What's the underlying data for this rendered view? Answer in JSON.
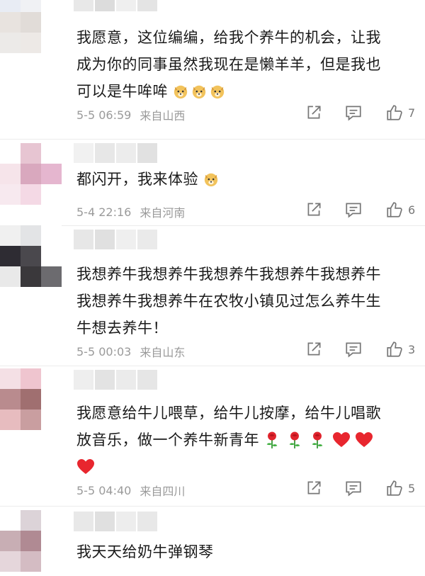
{
  "comments": [
    {
      "text_lines": [
        "我愿意，这位编编，给我个养牛的机会，让我",
        "成为你的同事虽然我现在是懒羊羊，但是我也",
        "可以是牛哞哞"
      ],
      "date": "5-5 06:59",
      "location": "来自山西",
      "likes": "7",
      "avatar_colors": [
        "#e8ecf4",
        "#f0f1f4",
        "#ffffff",
        "#e8e3df",
        "#e1dcd8",
        "#ffffff",
        "#eceae8",
        "#ede9e6",
        "#ffffff"
      ],
      "name_blur_colors": [
        "#e6e6e6",
        "#d9d9d9",
        "#eeeeee",
        "#e2e2e2"
      ]
    },
    {
      "text_lines": [
        "都闪开，我来体验"
      ],
      "date": "5-4 22:16",
      "location": "来自河南",
      "likes": "6",
      "avatar_colors": [
        "#ffffff",
        "#e7c5d2",
        "#ffffff",
        "#f6e4ea",
        "#d9a8be",
        "#e5b6cf",
        "#f7e9ef",
        "#f4d9e5",
        "#ffffff"
      ],
      "name_blur_colors": [
        "#f0f0f0",
        "#e5e5e5",
        "#ebebeb",
        "#dedede"
      ]
    },
    {
      "text_lines": [
        "我想养牛我想养牛我想养牛我想养牛我想养牛",
        "我想养牛我想养牛在农牧小镇见过怎么养牛生",
        "牛想去养牛！"
      ],
      "date": "5-5 00:03",
      "location": "来自山东",
      "likes": "3",
      "avatar_colors": [
        "#f0f0f0",
        "#e3e4e6",
        "#ffffff",
        "#2e2c33",
        "#4a484d",
        "#ffffff",
        "#e9e9e9",
        "#3a383b",
        "#6c6b6f"
      ],
      "name_blur_colors": [
        "#e4e4e4",
        "#dddddd",
        "#eeeeee",
        "#e8e8e8"
      ]
    },
    {
      "text_lines": [
        "我愿意给牛儿喂草，给牛儿按摩，给牛儿唱歌",
        "放音乐，做一个养牛新青年",
        ""
      ],
      "date": "5-5 04:40",
      "location": "来自四川",
      "likes": "5",
      "avatar_colors": [
        "#f4e0e5",
        "#efc5cf",
        "#ffffff",
        "#b98b8e",
        "#a06f70",
        "#ffffff",
        "#e7bcbf",
        "#c99ea0",
        "#ffffff"
      ],
      "name_blur_colors": [
        "#ececec",
        "#e0e0e0",
        "#e9e9e9",
        "#e4e4e4"
      ]
    },
    {
      "text_lines": [
        "我天天给奶牛弹钢琴"
      ],
      "avatar_colors": [
        "#ffffff",
        "#dcd3d8",
        "#ffffff",
        "#c8aeb4",
        "#b08a93",
        "#ffffff",
        "#e5d6db",
        "#d4bcc3",
        "#ffffff"
      ],
      "name_blur_colors": [
        "#e6e6e6",
        "#dddddd",
        "#ececec",
        "#e6e6e6"
      ]
    }
  ],
  "icons": {
    "share": "share-icon",
    "reply": "comment-icon",
    "like": "thumbs-up-icon",
    "doge": "doge-emoji-icon",
    "rose": "rose-emoji-icon",
    "heart": "heart-emoji-icon"
  }
}
